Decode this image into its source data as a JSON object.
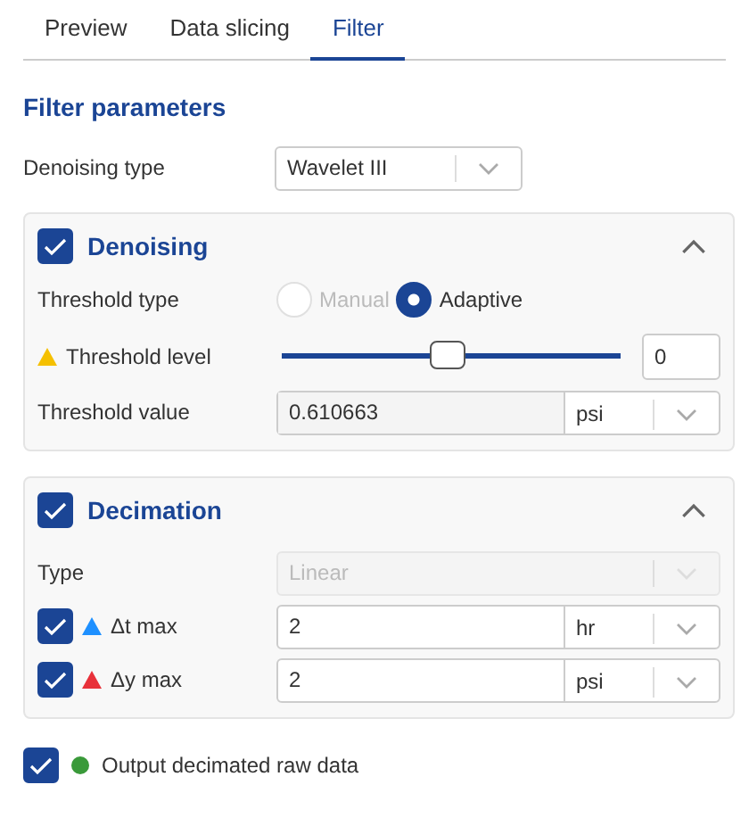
{
  "tabs": [
    {
      "label": "Preview",
      "selected": false
    },
    {
      "label": "Data slicing",
      "selected": false
    },
    {
      "label": "Filter",
      "selected": true
    }
  ],
  "heading": "Filter parameters",
  "denoising_type": {
    "label": "Denoising type",
    "value": "Wavelet III"
  },
  "denoising": {
    "title": "Denoising",
    "checked": true,
    "expanded": true,
    "threshold_type": {
      "label": "Threshold type",
      "options": [
        {
          "label": "Manual",
          "selected": false,
          "disabled": true
        },
        {
          "label": "Adaptive",
          "selected": true,
          "disabled": false
        }
      ]
    },
    "threshold_level": {
      "label": "Threshold level",
      "color": "#f5c000",
      "level": 0.49,
      "value": "0"
    },
    "threshold_value": {
      "label": "Threshold value",
      "value": "0.610663",
      "unit": "psi"
    }
  },
  "decimation": {
    "title": "Decimation",
    "checked": true,
    "expanded": true,
    "type": {
      "label": "Type",
      "value": "Linear",
      "disabled": true
    },
    "limits": [
      {
        "label": "Δt max",
        "checked": true,
        "color": "#1e90ff",
        "value": "2",
        "unit": "hr"
      },
      {
        "label": "Δy max",
        "checked": true,
        "color": "#e8313a",
        "value": "2",
        "unit": "psi"
      }
    ]
  },
  "output": {
    "label": "Output decimated raw data",
    "checked": true,
    "color": "#3a9a3a"
  }
}
